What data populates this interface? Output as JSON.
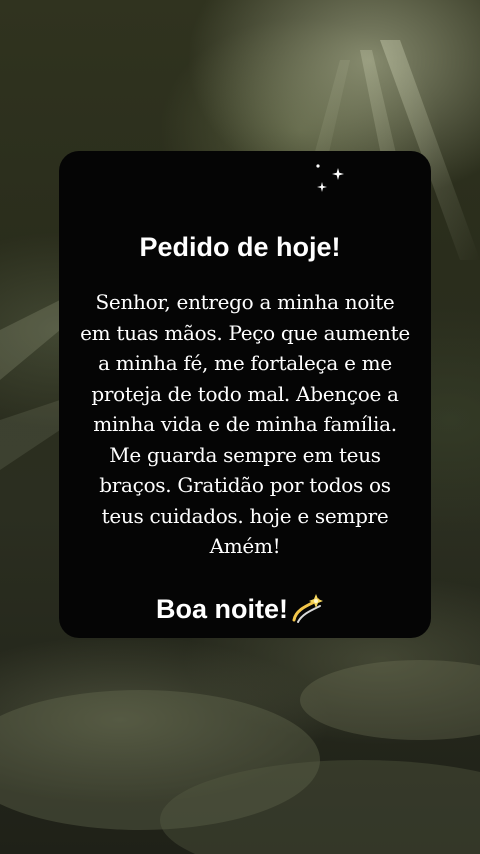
{
  "card": {
    "title": "Pedido de hoje!",
    "message": "Senhor, entrego a minha noite em tuas mãos. Peço que aumente a minha fé, me fortaleça e me proteja de todo mal. Abençoe a minha vida e de minha família. Me guarda sempre em teus braços. Gratidão por todos os teus cuidados. hoje e sempre Amém!",
    "closing": "Boa noite!",
    "closing_icon": "dizzy-emoji-icon",
    "decoration_icon": "sparkle-stars-icon"
  },
  "background": {
    "description_colors": [
      "#30331f",
      "#1f2118"
    ]
  }
}
